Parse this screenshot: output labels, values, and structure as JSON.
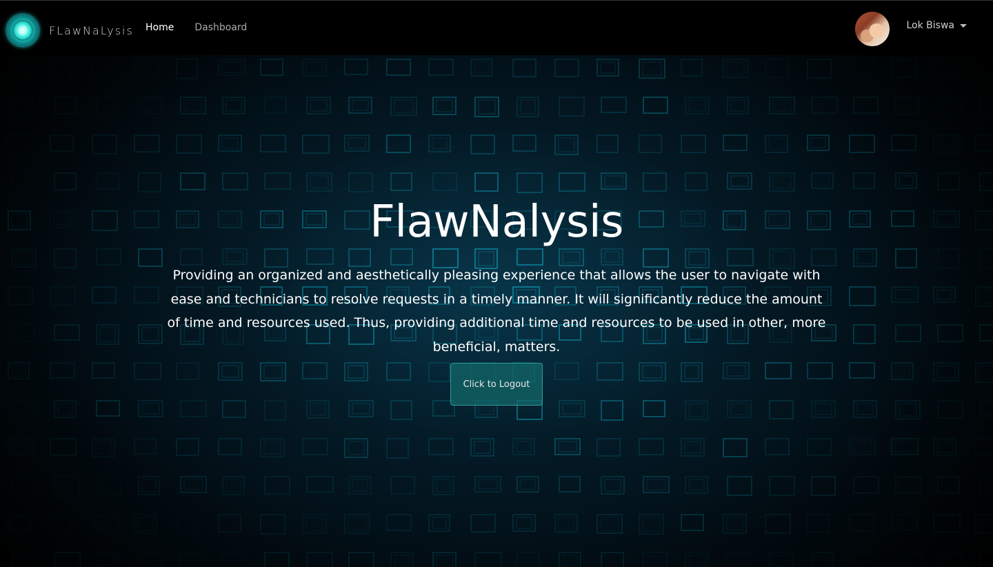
{
  "navbar": {
    "brand_text": "FLawNaLysis",
    "links": [
      {
        "label": "Home",
        "active": true
      },
      {
        "label": "Dashboard",
        "active": false
      }
    ],
    "user": {
      "name": "Lok Biswa"
    }
  },
  "hero": {
    "title": "FlawNalysis",
    "description": "Providing an organized and aesthetically pleasing experience that allows the user to navigate with ease and technicians to resolve requests in a timely manner. It will significantly reduce the amount of time and resources used. Thus, providing additional time and resources to be used in other, more beneficial, matters.",
    "button_label": "Click to Logout"
  },
  "colors": {
    "navbar_bg": "#000000",
    "accent": "#1fd6cc",
    "button_bg": "#146969",
    "button_border": "#2a9d9a",
    "grid_line": "#0fb8d6"
  }
}
